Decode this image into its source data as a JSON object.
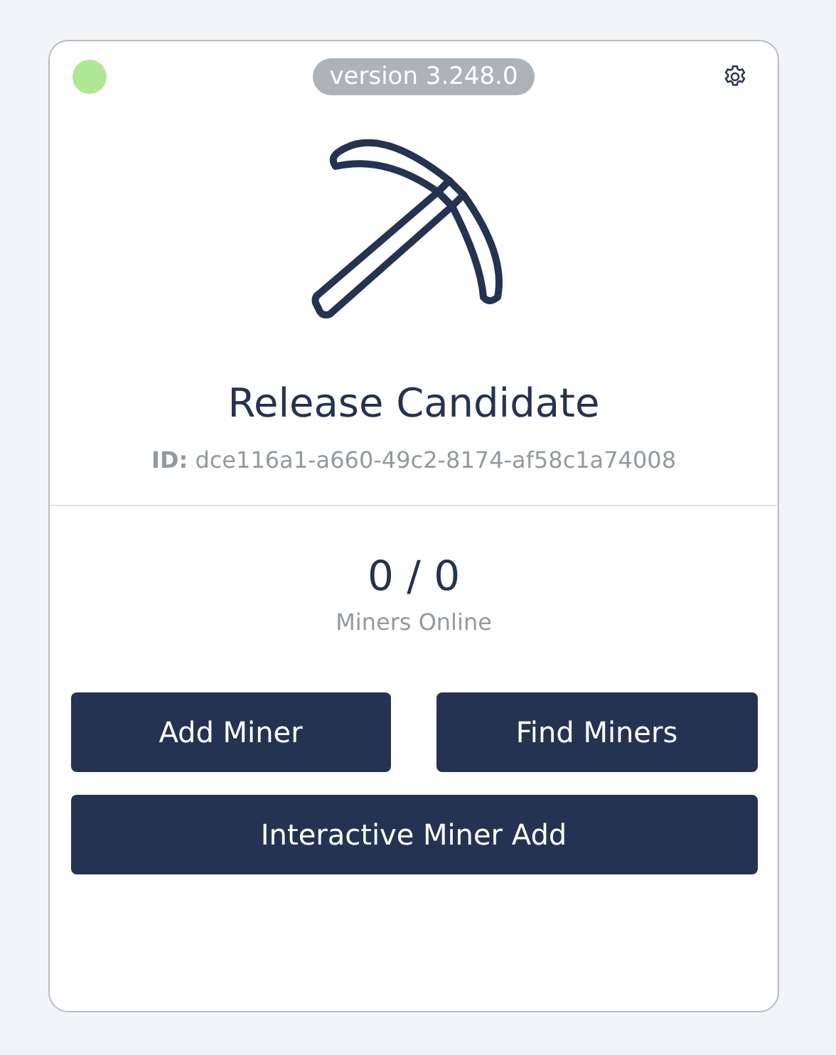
{
  "status": {
    "connected": true
  },
  "version": "version 3.248.0",
  "title": "Release Candidate",
  "id_line": "**ID:** dce116a1-a660-49c2-8174-af58c1a74008",
  "count": "0 / 0",
  "count_label": "Miners Online",
  "buttons": [
    "Add Miner",
    "Find Miners",
    "Interactive Miner Add"
  ]
}
